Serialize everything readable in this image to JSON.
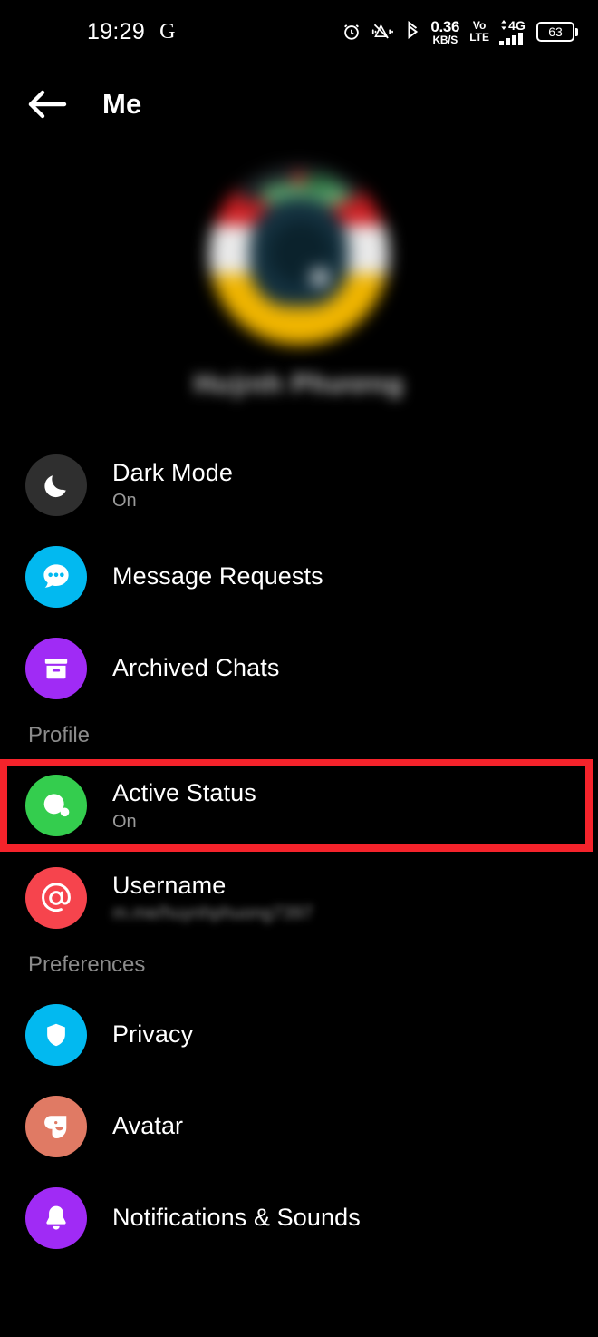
{
  "status_bar": {
    "time": "19:29",
    "assistant_glyph": "G",
    "icons": [
      "alarm-icon",
      "mute-icon",
      "bluetooth-icon"
    ],
    "network_speed_value": "0.36",
    "network_speed_unit": "KB/S",
    "volte_line1": "Vo",
    "volte_line2": "LTE",
    "signal_label": "4G",
    "battery_percent": "63"
  },
  "header": {
    "title": "Me",
    "back_icon": "arrow-left-icon"
  },
  "profile": {
    "name": "Huỳnh Phương",
    "name_redacted": true,
    "avatar_redacted": true
  },
  "colors": {
    "background": "#000000",
    "highlight": "#f5232b",
    "dark_mode_icon_bg": "#2f2f2f",
    "message_requests_icon_bg": "#02b9f0",
    "archived_chats_icon_bg": "#a02bf5",
    "active_status_icon_bg": "#34cd4e",
    "username_icon_bg": "#f6444d",
    "privacy_icon_bg": "#02b9f0",
    "avatar_icon_bg": "#e07a64",
    "notifications_icon_bg": "#a02bf5",
    "title_text": "#ffffff",
    "subtitle_text": "#9a9a9a",
    "section_label_text": "#8b8b8b"
  },
  "list": [
    {
      "kind": "row",
      "id": "dark-mode",
      "title": "Dark Mode",
      "subtitle": "On",
      "icon": "moon-icon",
      "highlighted": false
    },
    {
      "kind": "row",
      "id": "message-requests",
      "title": "Message Requests",
      "subtitle": "",
      "icon": "chat-bubble-dots-icon",
      "highlighted": false
    },
    {
      "kind": "row",
      "id": "archived-chats",
      "title": "Archived Chats",
      "subtitle": "",
      "icon": "archive-box-icon",
      "highlighted": false
    },
    {
      "kind": "section",
      "id": "profile",
      "label": "Profile"
    },
    {
      "kind": "row",
      "id": "active-status",
      "title": "Active Status",
      "subtitle": "On",
      "icon": "active-status-dot-icon",
      "highlighted": true
    },
    {
      "kind": "row",
      "id": "username",
      "title": "Username",
      "subtitle": "m.me/huynhphuong7397",
      "subtitle_redacted": true,
      "icon": "at-sign-icon",
      "highlighted": false
    },
    {
      "kind": "section",
      "id": "preferences",
      "label": "Preferences"
    },
    {
      "kind": "row",
      "id": "privacy",
      "title": "Privacy",
      "subtitle": "",
      "icon": "shield-icon",
      "highlighted": false
    },
    {
      "kind": "row",
      "id": "avatar",
      "title": "Avatar",
      "subtitle": "",
      "icon": "avatar-face-icon",
      "highlighted": false
    },
    {
      "kind": "row",
      "id": "notifications-sounds",
      "title": "Notifications & Sounds",
      "subtitle": "",
      "icon": "bell-icon",
      "highlighted": false
    }
  ]
}
